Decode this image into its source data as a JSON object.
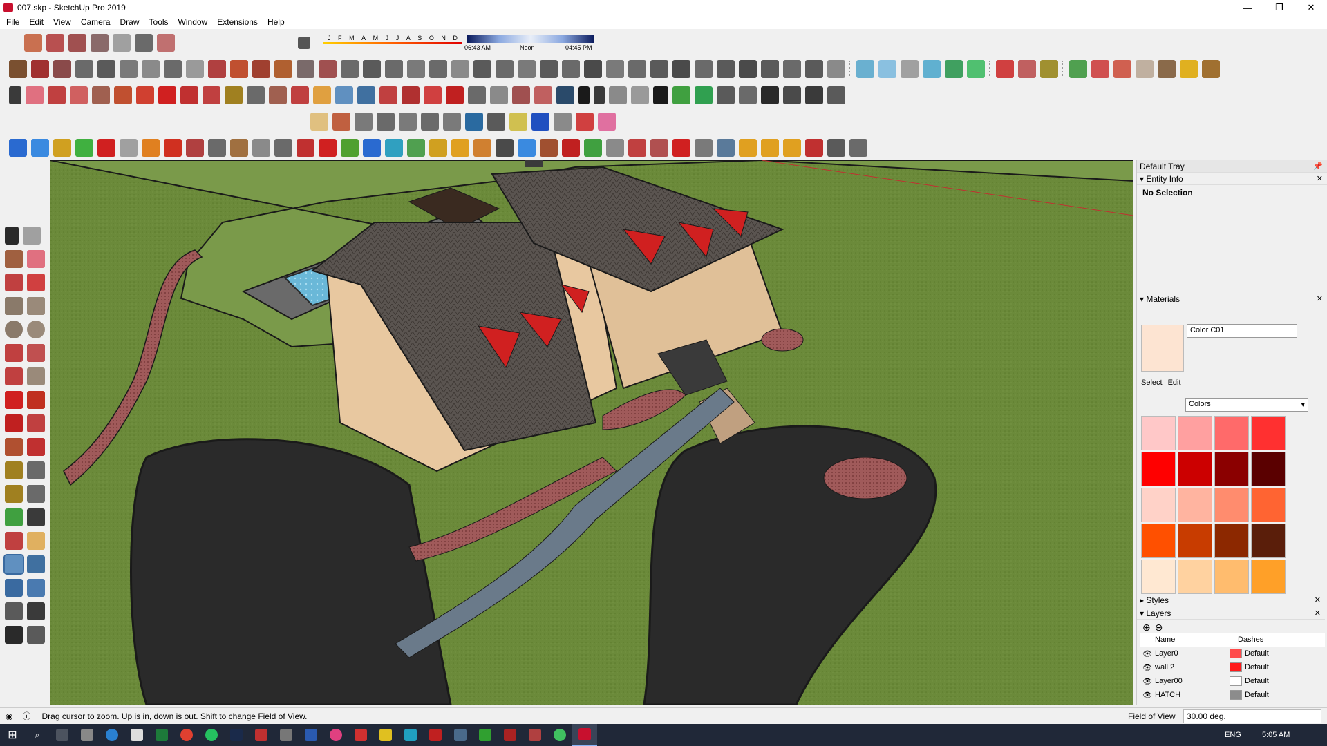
{
  "window": {
    "title": "007.skp - SketchUp Pro 2019",
    "minimize_icon": "minimize-icon",
    "maximize_icon": "restore-icon",
    "close_icon": "close-icon"
  },
  "menu": [
    "File",
    "Edit",
    "View",
    "Camera",
    "Draw",
    "Tools",
    "Window",
    "Extensions",
    "Help"
  ],
  "shadows": {
    "months": [
      "J",
      "F",
      "M",
      "A",
      "M",
      "J",
      "J",
      "A",
      "S",
      "O",
      "N",
      "D"
    ],
    "time_start": "06:43 AM",
    "time_mid": "Noon",
    "time_end": "04:45 PM"
  },
  "tray": {
    "title": "Default Tray",
    "entity_info": {
      "header": "Entity Info",
      "selection": "No Selection"
    },
    "materials": {
      "header": "Materials",
      "current_name": "Color C01",
      "current_color": "#fde4d2",
      "tabs": [
        "Select",
        "Edit"
      ],
      "library": "Colors",
      "swatches": [
        "#ffc8c8",
        "#ffa0a0",
        "#ff6a6a",
        "#ff3030",
        "#ff0000",
        "#cc0000",
        "#8b0000",
        "#5a0000",
        "#ffd2c8",
        "#ffb4a0",
        "#ff8c6e",
        "#ff6432",
        "#ff5000",
        "#c83c00",
        "#8c2800",
        "#5a1e0a",
        "#ffe8d2",
        "#ffd2a0",
        "#ffbc6e",
        "#ffa028"
      ]
    },
    "styles": {
      "header": "Styles"
    },
    "layers": {
      "header": "Layers",
      "col_name": "Name",
      "col_dashes": "Dashes",
      "rows": [
        {
          "name": "Layer0",
          "color": "#ff4a4a",
          "dashes": "Default"
        },
        {
          "name": "wall 2",
          "color": "#ff1a1a",
          "dashes": "Default"
        },
        {
          "name": "Layer00",
          "color": "#ffffff",
          "dashes": "Default"
        },
        {
          "name": "HATCH",
          "color": "#8c8c8c",
          "dashes": "Default"
        }
      ]
    }
  },
  "status": {
    "message": "Drag cursor to zoom.  Up is in, down is out. Shift to change Field of View.",
    "measure_label": "Field of View",
    "measure_value": "30.00 deg."
  },
  "taskbar": {
    "time": "5:05 AM",
    "lang": "ENG"
  }
}
